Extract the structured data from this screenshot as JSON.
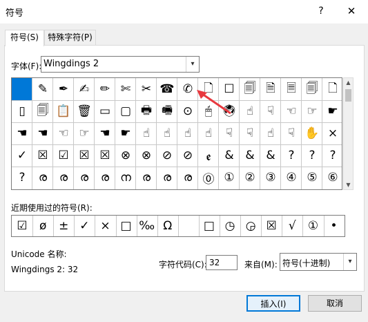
{
  "window": {
    "title": "符号",
    "help": "?",
    "close": "✕"
  },
  "tabs": [
    {
      "label": "符号(S)",
      "active": true
    },
    {
      "label": "特殊字符(P)",
      "active": false
    }
  ],
  "font": {
    "label": "字体(F):",
    "value": "Wingdings 2"
  },
  "symbol_grid": [
    [
      "",
      "✎",
      "✒",
      "✍",
      "✏",
      "✄",
      "✂",
      "☎",
      "✆",
      "🗋",
      "☐",
      "🗐",
      "🗎",
      "🗏",
      "🗐",
      "🗋"
    ],
    [
      "▯",
      "🗐",
      "📋",
      "🗑",
      "▭",
      "▢",
      "🖶",
      "🖷",
      "⊙",
      "🖱",
      "🖲",
      "☝",
      "☟",
      "☜",
      "☞",
      "☛"
    ],
    [
      "☚",
      "☚",
      "☜",
      "☞",
      "☚",
      "☛",
      "☝",
      "☝",
      "☝",
      "☝",
      "☟",
      "☟",
      "☝",
      "☟",
      "✋",
      "×"
    ],
    [
      "✓",
      "☒",
      "☑",
      "☒",
      "☒",
      "⊗",
      "⊗",
      "⊘",
      "⊘",
      "ꬲ",
      "&",
      "&",
      "&",
      "?",
      "?",
      "?"
    ],
    [
      "?",
      "ര",
      "ര",
      "ര",
      "ര",
      "ന",
      "ര",
      "ര",
      "ര",
      "⓪",
      "①",
      "②",
      "③",
      "④",
      "⑤",
      "⑥"
    ]
  ],
  "recent": {
    "label": "近期使用过的符号(R):",
    "symbols": [
      "☑",
      "ø",
      "±",
      "✓",
      "×",
      "□",
      "‰",
      "Ω",
      "",
      "□",
      "◷",
      "◶",
      "☒",
      "√",
      "①",
      "•"
    ]
  },
  "unicode_name": {
    "label": "Unicode 名称:",
    "value": "Wingdings 2: 32"
  },
  "char_code": {
    "label": "字符代码(C):",
    "value": "32"
  },
  "from": {
    "label": "来自(M):",
    "value": "符号(十进制)"
  },
  "buttons": {
    "insert": "插入(I)",
    "cancel": "取消"
  },
  "colors": {
    "selection": "#0078d7",
    "arrow": "#e8393f"
  }
}
